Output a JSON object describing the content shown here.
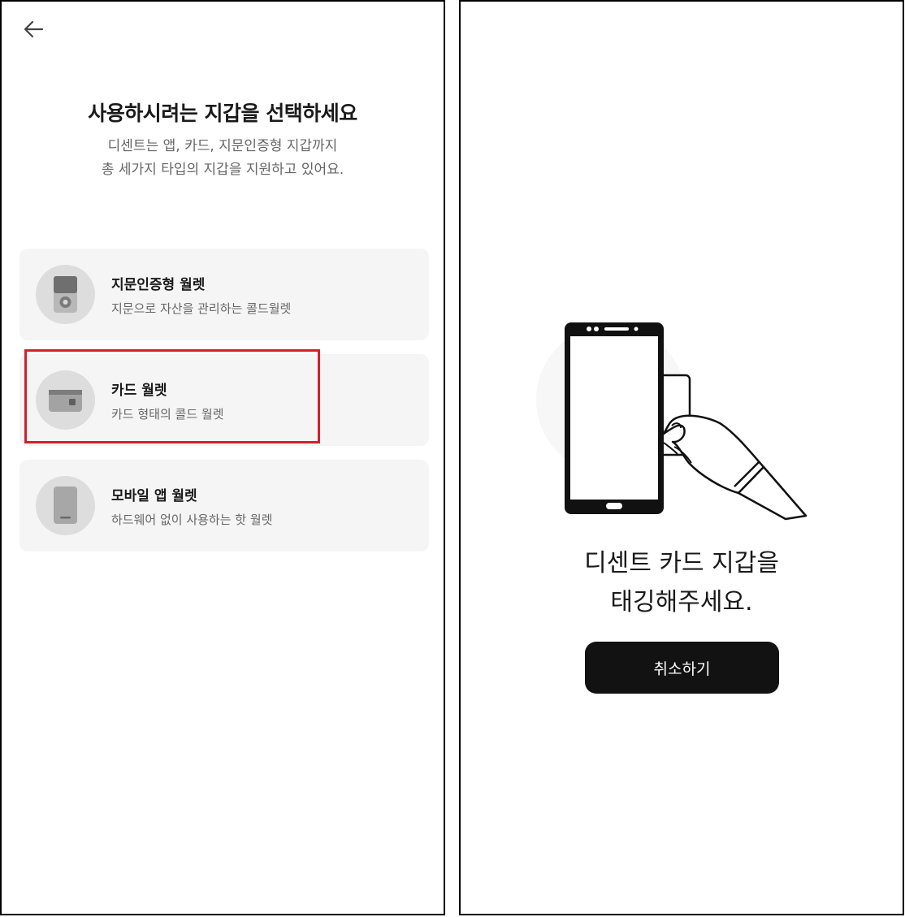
{
  "wallet_select": {
    "title": "사용하시려는 지갑을 선택하세요",
    "subtitle_line1": "디센트는 앱, 카드, 지문인증형 지갑까지",
    "subtitle_line2": "총 세가지 타입의 지갑을 지원하고 있어요.",
    "options": [
      {
        "title": "지문인증형 월렛",
        "description": "지문으로 자산을 관리하는 콜드월렛",
        "icon": "fingerprint-device-icon"
      },
      {
        "title": "카드 월렛",
        "description": "카드 형태의 콜드 월렛",
        "icon": "card-icon",
        "highlighted": true
      },
      {
        "title": "모바일 앱 월렛",
        "description": "하드웨어 없이 사용하는 핫 월렛",
        "icon": "mobile-phone-icon"
      }
    ],
    "highlight_color": "#d32029"
  },
  "tag_screen": {
    "message_line1": "디센트 카드 지갑을",
    "message_line2": "태깅해주세요.",
    "cancel_label": "취소하기",
    "illustration": "hand-tapping-card-to-phone"
  }
}
